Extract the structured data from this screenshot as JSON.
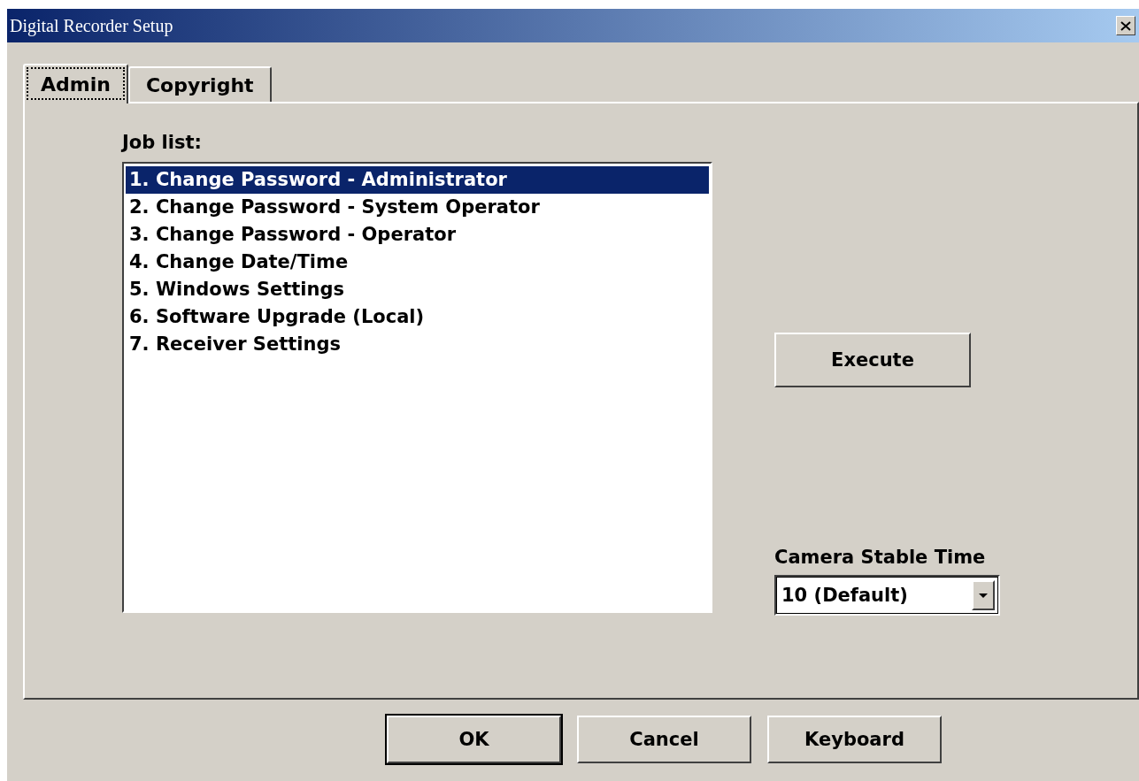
{
  "window": {
    "title": "Digital Recorder Setup"
  },
  "tabs": [
    {
      "label": "Admin",
      "selected": true
    },
    {
      "label": "Copyright",
      "selected": false
    }
  ],
  "job_list": {
    "label": "Job list:",
    "items": [
      {
        "label": "1. Change Password - Administrator",
        "selected": true
      },
      {
        "label": "2. Change Password - System Operator",
        "selected": false
      },
      {
        "label": "3. Change Password - Operator",
        "selected": false
      },
      {
        "label": "4. Change Date/Time",
        "selected": false
      },
      {
        "label": "5. Windows Settings",
        "selected": false
      },
      {
        "label": "6. Software Upgrade (Local)",
        "selected": false
      },
      {
        "label": "7. Receiver Settings",
        "selected": false
      }
    ]
  },
  "execute_button": "Execute",
  "camera_stable_time": {
    "label": "Camera Stable Time",
    "value": "10 (Default)"
  },
  "buttons": [
    {
      "label": "OK",
      "default": true
    },
    {
      "label": "Cancel",
      "default": false
    },
    {
      "label": "Keyboard",
      "default": false
    }
  ]
}
